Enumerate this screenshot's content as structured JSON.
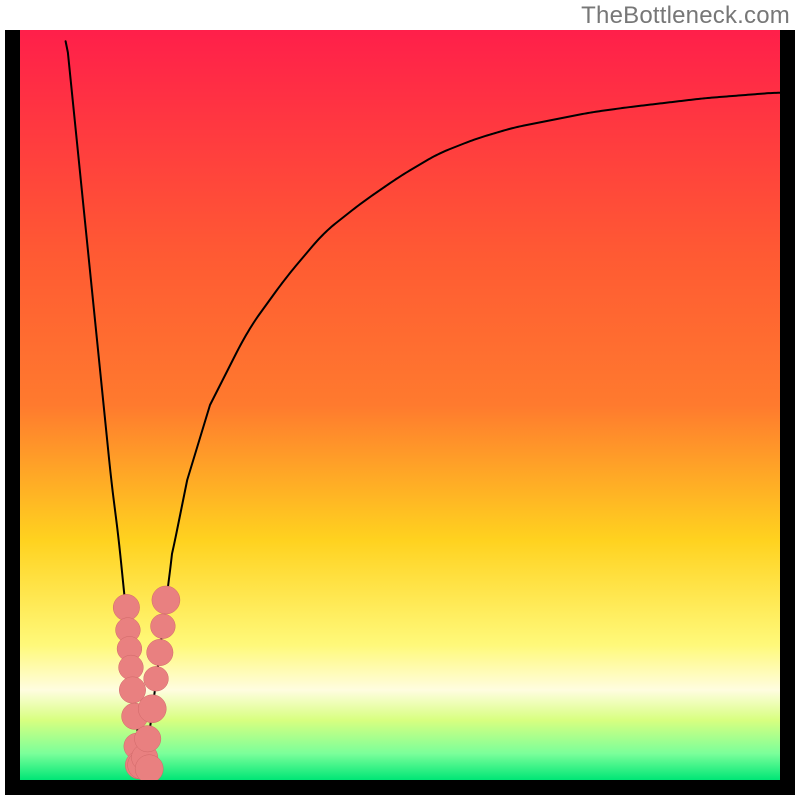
{
  "watermark": "TheBottleneck.com",
  "colors": {
    "bg_top": "#ff1f4a",
    "bg_mid1": "#ff7a2e",
    "bg_mid2": "#ffd21f",
    "bg_mid3": "#fff97a",
    "bg_mid4": "#d8ff80",
    "bg_bot": "#00e676",
    "curve": "#000000",
    "marker_fill": "#e98080",
    "marker_stroke": "#d06868"
  },
  "chart_data": {
    "type": "line",
    "title": "",
    "xlabel": "",
    "ylabel": "",
    "xlim": [
      0,
      100
    ],
    "ylim": [
      0,
      100
    ],
    "series": [
      {
        "name": "bottleneck-curve",
        "x": [
          6,
          7,
          8,
          9,
          10,
          11,
          12,
          13,
          14,
          15,
          15.5,
          16,
          17,
          18,
          19,
          20,
          22,
          25,
          30,
          35,
          40,
          45,
          50,
          55,
          60,
          65,
          70,
          75,
          80,
          85,
          90,
          95,
          100
        ],
        "y": [
          100,
          90,
          80,
          70,
          60,
          50,
          40,
          32,
          22,
          12,
          6,
          2,
          6,
          14,
          22,
          30,
          40,
          50,
          60,
          67,
          73,
          77,
          80.5,
          83.5,
          85.5,
          87,
          88,
          89,
          89.7,
          90.3,
          90.9,
          91.3,
          91.7
        ]
      }
    ],
    "markers": [
      {
        "x": 14.0,
        "y": 23.0,
        "r": 1.1
      },
      {
        "x": 14.2,
        "y": 20.0,
        "r": 1.0
      },
      {
        "x": 14.4,
        "y": 17.5,
        "r": 1.0
      },
      {
        "x": 14.6,
        "y": 15.0,
        "r": 1.0
      },
      {
        "x": 14.8,
        "y": 12.0,
        "r": 1.1
      },
      {
        "x": 15.1,
        "y": 8.5,
        "r": 1.1
      },
      {
        "x": 15.4,
        "y": 4.5,
        "r": 1.1
      },
      {
        "x": 15.7,
        "y": 2.0,
        "r": 1.2
      },
      {
        "x": 16.0,
        "y": 2.0,
        "r": 1.2
      },
      {
        "x": 16.4,
        "y": 3.0,
        "r": 1.1
      },
      {
        "x": 16.8,
        "y": 5.5,
        "r": 1.1
      },
      {
        "x": 17.4,
        "y": 9.5,
        "r": 1.2
      },
      {
        "x": 17.9,
        "y": 13.5,
        "r": 1.0
      },
      {
        "x": 18.4,
        "y": 17.0,
        "r": 1.1
      },
      {
        "x": 18.8,
        "y": 20.5,
        "r": 1.0
      },
      {
        "x": 19.2,
        "y": 24.0,
        "r": 1.2
      },
      {
        "x": 17.0,
        "y": 1.5,
        "r": 1.2
      }
    ]
  }
}
